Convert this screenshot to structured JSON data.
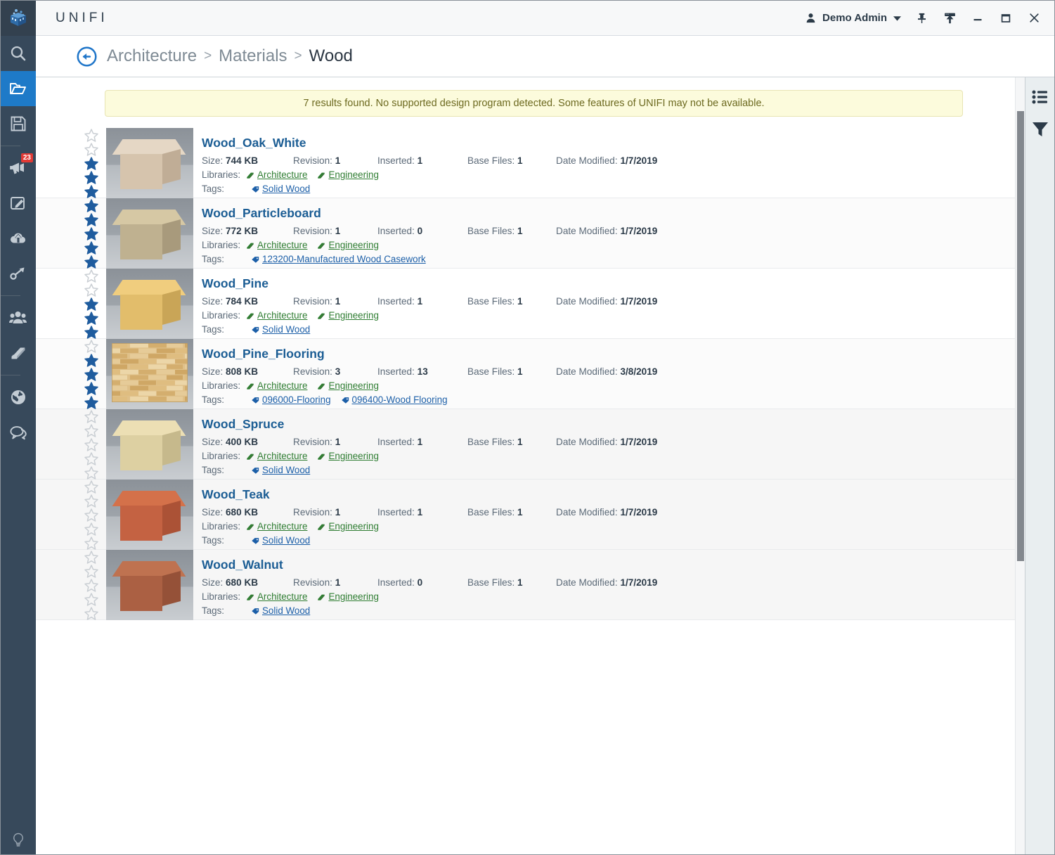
{
  "app": {
    "brand": "UNIFI",
    "logo_icon": "unifi-cube-logo"
  },
  "titlebar": {
    "user_icon": "user-icon",
    "user_name": "Demo Admin",
    "caret_icon": "chevron-down-icon",
    "pin_icon": "pin-icon",
    "upload_icon": "upload-icon",
    "minimize_icon": "minimize-icon",
    "maximize_icon": "maximize-icon",
    "close_icon": "close-icon"
  },
  "breadcrumb": {
    "back_icon": "back-arrow-circle-icon",
    "separator": ">",
    "items": [
      {
        "label": "Architecture",
        "current": false
      },
      {
        "label": "Materials",
        "current": false
      },
      {
        "label": "Wood",
        "current": true
      }
    ]
  },
  "sidebar": {
    "items": [
      {
        "name": "search",
        "icon": "search-icon",
        "active": false,
        "badge": null
      },
      {
        "name": "library",
        "icon": "open-folder-icon",
        "active": true,
        "badge": null
      },
      {
        "name": "saved",
        "icon": "floppy-disk-icon",
        "active": false,
        "badge": null
      },
      {
        "name": "announcements",
        "icon": "megaphone-icon",
        "active": false,
        "badge": "23"
      },
      {
        "name": "content-edit",
        "icon": "pencil-square-icon",
        "active": false,
        "badge": null
      },
      {
        "name": "upload",
        "icon": "cloud-upload-icon",
        "active": false,
        "badge": null
      },
      {
        "name": "batch-tools",
        "icon": "link-arrow-icon",
        "active": false,
        "badge": null
      },
      {
        "name": "users",
        "icon": "people-icon",
        "active": false,
        "badge": null
      },
      {
        "name": "library-manager",
        "icon": "book-icon",
        "active": false,
        "badge": null
      },
      {
        "name": "global",
        "icon": "globe-icon",
        "active": false,
        "badge": null
      },
      {
        "name": "messages",
        "icon": "chat-bubbles-icon",
        "active": false,
        "badge": null
      }
    ],
    "bottom_item": {
      "name": "tips",
      "icon": "lightbulb-icon"
    }
  },
  "toolpanel": {
    "items": [
      {
        "name": "list-view",
        "icon": "list-view-icon"
      },
      {
        "name": "filter",
        "icon": "filter-funnel-icon"
      }
    ]
  },
  "banner": {
    "text": "7 results found. No supported design program detected. Some features of UNIFI may not be available."
  },
  "labels": {
    "size": "Size:",
    "revision": "Revision:",
    "inserted": "Inserted:",
    "base_files": "Base Files:",
    "date_modified": "Date Modified:",
    "libraries": "Libraries:",
    "tags": "Tags:"
  },
  "results": [
    {
      "title": "Wood_Oak_White",
      "rating": 3,
      "size": "744 KB",
      "revision": "1",
      "inserted": "1",
      "base_files": "1",
      "date_modified": "1/7/2019",
      "libraries": [
        "Architecture",
        "Engineering"
      ],
      "tags": [
        "Solid Wood"
      ],
      "thumb": {
        "type": "cube",
        "top": "#e5d7c5",
        "front": "#d6c4ad",
        "side": "#c0ad96"
      }
    },
    {
      "title": "Wood_Particleboard",
      "rating": 5,
      "size": "772 KB",
      "revision": "1",
      "inserted": "0",
      "base_files": "1",
      "date_modified": "1/7/2019",
      "libraries": [
        "Architecture",
        "Engineering"
      ],
      "tags": [
        "123200-Manufactured Wood Casework"
      ],
      "thumb": {
        "type": "cube",
        "top": "#d6c8a4",
        "front": "#bfb190",
        "side": "#a89a7c"
      }
    },
    {
      "title": "Wood_Pine",
      "rating": 3,
      "size": "784 KB",
      "revision": "1",
      "inserted": "1",
      "base_files": "1",
      "date_modified": "1/7/2019",
      "libraries": [
        "Architecture",
        "Engineering"
      ],
      "tags": [
        "Solid Wood"
      ],
      "thumb": {
        "type": "cube",
        "top": "#f0cd7e",
        "front": "#e2bd6b",
        "side": "#c9a557"
      }
    },
    {
      "title": "Wood_Pine_Flooring",
      "rating": 4,
      "size": "808 KB",
      "revision": "3",
      "inserted": "13",
      "base_files": "1",
      "date_modified": "3/8/2019",
      "libraries": [
        "Architecture",
        "Engineering"
      ],
      "tags": [
        "096000-Flooring",
        "096400-Wood Flooring"
      ],
      "thumb": {
        "type": "planks",
        "top": "#e8c98f",
        "front": "#dfc089",
        "side": "#c9a76f"
      }
    },
    {
      "title": "Wood_Spruce",
      "rating": 0,
      "size": "400 KB",
      "revision": "1",
      "inserted": "1",
      "base_files": "1",
      "date_modified": "1/7/2019",
      "libraries": [
        "Architecture",
        "Engineering"
      ],
      "tags": [
        "Solid Wood"
      ],
      "thumb": {
        "type": "cube",
        "top": "#ecdfb4",
        "front": "#ddd0a2",
        "side": "#c6b98c"
      }
    },
    {
      "title": "Wood_Teak",
      "rating": 0,
      "size": "680 KB",
      "revision": "1",
      "inserted": "1",
      "base_files": "1",
      "date_modified": "1/7/2019",
      "libraries": [
        "Architecture",
        "Engineering"
      ],
      "tags": [
        "Solid Wood"
      ],
      "thumb": {
        "type": "cube",
        "top": "#d4714a",
        "front": "#c46242",
        "side": "#ab5236"
      }
    },
    {
      "title": "Wood_Walnut",
      "rating": 0,
      "size": "680 KB",
      "revision": "1",
      "inserted": "0",
      "base_files": "1",
      "date_modified": "1/7/2019",
      "libraries": [
        "Architecture",
        "Engineering"
      ],
      "tags": [
        "Solid Wood"
      ],
      "thumb": {
        "type": "cube",
        "top": "#bf7250",
        "front": "#ab6043",
        "side": "#955138"
      }
    }
  ],
  "colors": {
    "rail_bg": "#37495b",
    "rail_active": "#1e7ac8",
    "accent_blue": "#1b5d94",
    "link_green": "#2f7d32",
    "link_blue": "#1c5fa8",
    "star_filled": "#1f5c9e",
    "star_empty": "#c9ced3",
    "banner_bg": "#fcfbdc",
    "badge_red": "#e23a35"
  },
  "max_rating": 5
}
